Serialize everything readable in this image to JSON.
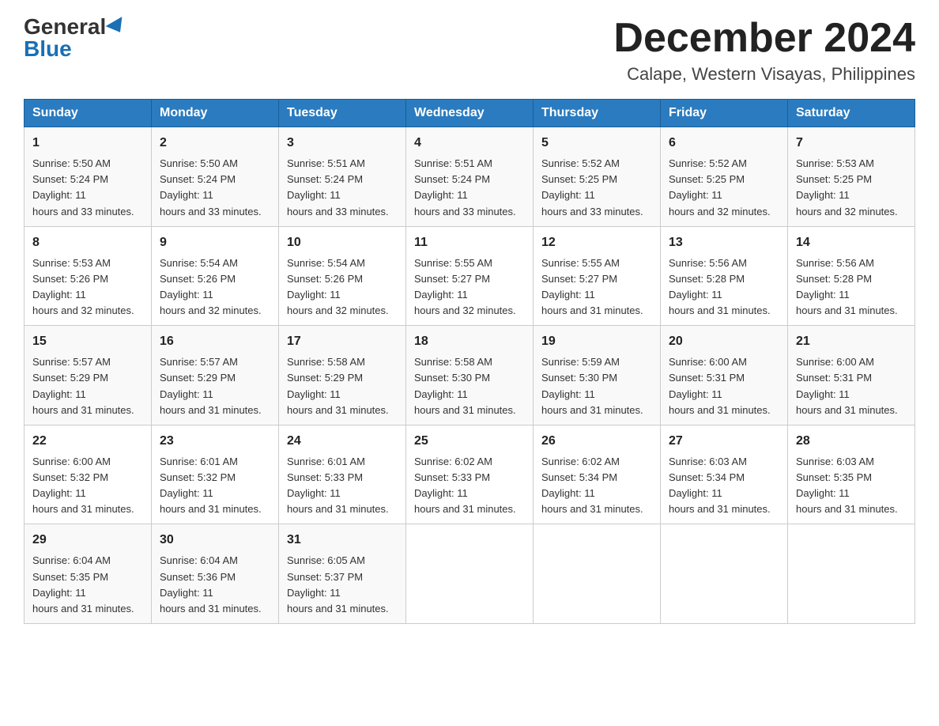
{
  "header": {
    "logo_general": "General",
    "logo_blue": "Blue",
    "month_year": "December 2024",
    "location": "Calape, Western Visayas, Philippines"
  },
  "days_of_week": [
    "Sunday",
    "Monday",
    "Tuesday",
    "Wednesday",
    "Thursday",
    "Friday",
    "Saturday"
  ],
  "weeks": [
    [
      {
        "day": "1",
        "sunrise": "5:50 AM",
        "sunset": "5:24 PM",
        "daylight": "11 hours and 33 minutes."
      },
      {
        "day": "2",
        "sunrise": "5:50 AM",
        "sunset": "5:24 PM",
        "daylight": "11 hours and 33 minutes."
      },
      {
        "day": "3",
        "sunrise": "5:51 AM",
        "sunset": "5:24 PM",
        "daylight": "11 hours and 33 minutes."
      },
      {
        "day": "4",
        "sunrise": "5:51 AM",
        "sunset": "5:24 PM",
        "daylight": "11 hours and 33 minutes."
      },
      {
        "day": "5",
        "sunrise": "5:52 AM",
        "sunset": "5:25 PM",
        "daylight": "11 hours and 33 minutes."
      },
      {
        "day": "6",
        "sunrise": "5:52 AM",
        "sunset": "5:25 PM",
        "daylight": "11 hours and 32 minutes."
      },
      {
        "day": "7",
        "sunrise": "5:53 AM",
        "sunset": "5:25 PM",
        "daylight": "11 hours and 32 minutes."
      }
    ],
    [
      {
        "day": "8",
        "sunrise": "5:53 AM",
        "sunset": "5:26 PM",
        "daylight": "11 hours and 32 minutes."
      },
      {
        "day": "9",
        "sunrise": "5:54 AM",
        "sunset": "5:26 PM",
        "daylight": "11 hours and 32 minutes."
      },
      {
        "day": "10",
        "sunrise": "5:54 AM",
        "sunset": "5:26 PM",
        "daylight": "11 hours and 32 minutes."
      },
      {
        "day": "11",
        "sunrise": "5:55 AM",
        "sunset": "5:27 PM",
        "daylight": "11 hours and 32 minutes."
      },
      {
        "day": "12",
        "sunrise": "5:55 AM",
        "sunset": "5:27 PM",
        "daylight": "11 hours and 31 minutes."
      },
      {
        "day": "13",
        "sunrise": "5:56 AM",
        "sunset": "5:28 PM",
        "daylight": "11 hours and 31 minutes."
      },
      {
        "day": "14",
        "sunrise": "5:56 AM",
        "sunset": "5:28 PM",
        "daylight": "11 hours and 31 minutes."
      }
    ],
    [
      {
        "day": "15",
        "sunrise": "5:57 AM",
        "sunset": "5:29 PM",
        "daylight": "11 hours and 31 minutes."
      },
      {
        "day": "16",
        "sunrise": "5:57 AM",
        "sunset": "5:29 PM",
        "daylight": "11 hours and 31 minutes."
      },
      {
        "day": "17",
        "sunrise": "5:58 AM",
        "sunset": "5:29 PM",
        "daylight": "11 hours and 31 minutes."
      },
      {
        "day": "18",
        "sunrise": "5:58 AM",
        "sunset": "5:30 PM",
        "daylight": "11 hours and 31 minutes."
      },
      {
        "day": "19",
        "sunrise": "5:59 AM",
        "sunset": "5:30 PM",
        "daylight": "11 hours and 31 minutes."
      },
      {
        "day": "20",
        "sunrise": "6:00 AM",
        "sunset": "5:31 PM",
        "daylight": "11 hours and 31 minutes."
      },
      {
        "day": "21",
        "sunrise": "6:00 AM",
        "sunset": "5:31 PM",
        "daylight": "11 hours and 31 minutes."
      }
    ],
    [
      {
        "day": "22",
        "sunrise": "6:00 AM",
        "sunset": "5:32 PM",
        "daylight": "11 hours and 31 minutes."
      },
      {
        "day": "23",
        "sunrise": "6:01 AM",
        "sunset": "5:32 PM",
        "daylight": "11 hours and 31 minutes."
      },
      {
        "day": "24",
        "sunrise": "6:01 AM",
        "sunset": "5:33 PM",
        "daylight": "11 hours and 31 minutes."
      },
      {
        "day": "25",
        "sunrise": "6:02 AM",
        "sunset": "5:33 PM",
        "daylight": "11 hours and 31 minutes."
      },
      {
        "day": "26",
        "sunrise": "6:02 AM",
        "sunset": "5:34 PM",
        "daylight": "11 hours and 31 minutes."
      },
      {
        "day": "27",
        "sunrise": "6:03 AM",
        "sunset": "5:34 PM",
        "daylight": "11 hours and 31 minutes."
      },
      {
        "day": "28",
        "sunrise": "6:03 AM",
        "sunset": "5:35 PM",
        "daylight": "11 hours and 31 minutes."
      }
    ],
    [
      {
        "day": "29",
        "sunrise": "6:04 AM",
        "sunset": "5:35 PM",
        "daylight": "11 hours and 31 minutes."
      },
      {
        "day": "30",
        "sunrise": "6:04 AM",
        "sunset": "5:36 PM",
        "daylight": "11 hours and 31 minutes."
      },
      {
        "day": "31",
        "sunrise": "6:05 AM",
        "sunset": "5:37 PM",
        "daylight": "11 hours and 31 minutes."
      },
      null,
      null,
      null,
      null
    ]
  ]
}
